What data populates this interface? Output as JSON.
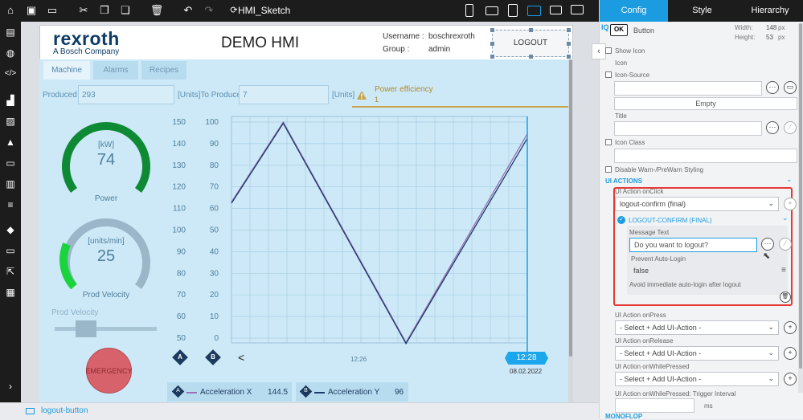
{
  "toolbar": {
    "app_title": "HMI_Sketch"
  },
  "hmi": {
    "brand": "rexroth",
    "brand_sub": "A Bosch Company",
    "title": "DEMO HMI",
    "username_label": "Username :",
    "username": "boschrexroth",
    "group_label": "Group :",
    "group": "admin",
    "logout_label": "LOGOUT",
    "tabs": [
      "Machine",
      "Alarms",
      "Recipes"
    ],
    "produced_label": "Produced",
    "produced_value": "293",
    "units_to_produce_label": "[Units]To Produce",
    "to_produce_value": "7",
    "units_label": "[Units]",
    "alert_title": "Power efficiency",
    "alert_value": "1",
    "gauge_power": {
      "unit": "[kW]",
      "value": "74",
      "label": "Power"
    },
    "gauge_velocity": {
      "unit": "[units/min]",
      "value": "25",
      "label": "Prod Velocity"
    },
    "slider_label": "Prod Velocity",
    "emergency_label": "EMERGENCY",
    "chart_time_label": "12:26",
    "cursor_time": "12:28",
    "cursor_date": "08.02.2022",
    "legend": [
      {
        "marker": "A",
        "name": "Acceleration X",
        "value": "144.5"
      },
      {
        "marker": "B",
        "name": "Acceleration Y",
        "value": "96"
      }
    ],
    "nav_markers": [
      "A",
      "B"
    ],
    "nav_prev": "<"
  },
  "chart_data": {
    "type": "line",
    "y_axis_left": {
      "ticks": [
        150,
        140,
        130,
        120,
        110,
        100,
        90,
        80,
        70,
        60,
        50
      ]
    },
    "y_axis_right": {
      "ticks": [
        100,
        90,
        80,
        70,
        60,
        50,
        40,
        30,
        20,
        10,
        0
      ]
    },
    "x_tick_labels": [
      "12:26"
    ],
    "series": [
      {
        "name": "Acceleration X",
        "color": "#9a6fb4",
        "values": [
          113,
          150,
          48,
          144.5
        ]
      },
      {
        "name": "Acceleration Y",
        "color": "#1b3b6a",
        "values": [
          113,
          150,
          48,
          143
        ]
      }
    ]
  },
  "status": {
    "selected": "logout-button"
  },
  "panel": {
    "tabs": [
      "Config",
      "Style",
      "Hierarchy"
    ],
    "component_badge": "OK",
    "component_name": "Button",
    "width_label": "Width:",
    "width_value": "148",
    "height_label": "Height:",
    "height_value": "53",
    "unit_px": "px",
    "show_icon": "Show Icon",
    "icon": "Icon",
    "icon_source": "Icon-Source",
    "empty": "Empty",
    "title": "Title",
    "icon_class": "Icon Class",
    "disable_warn": "Disable Warn-/PreWarn Styling",
    "ui_actions": "UI ACTIONS",
    "on_click": "UI Action onClick",
    "on_click_value": "logout-confirm (final)",
    "logout_confirm": "LOGOUT-CONFIRM (FINAL)",
    "message_text": "Message Text",
    "message_value": "Do you want to logout?",
    "prevent_autologin": "Prevent Auto-Login",
    "prevent_value": "false",
    "avoid_hint": "Avoid immediate auto-login after logout",
    "on_press": "UI Action onPress",
    "on_release": "UI Action onRelease",
    "on_while_pressed": "UI Action onWhilePressed",
    "select_add": "- Select + Add UI-Action -",
    "trigger_interval": "UI Action onWhilePressed: Trigger Interval",
    "ms": "ms",
    "bottom_heading": "MONOFLOP"
  },
  "colors": {
    "accent": "#1b9be0",
    "highlight": "#e53935",
    "gauge_green": "#149a3b"
  }
}
